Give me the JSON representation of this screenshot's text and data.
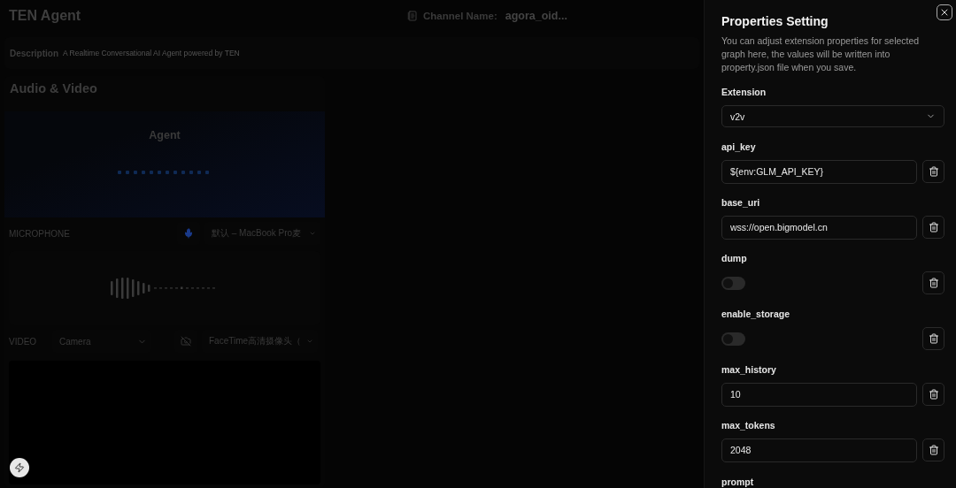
{
  "header": {
    "title": "TEN Agent",
    "channel_label": "Channel Name:",
    "channel_value": "agora_oid..."
  },
  "description": {
    "label": "Description",
    "text": "A Realtime Conversational AI Agent powered by TEN"
  },
  "audio_video": {
    "title": "Audio & Video",
    "agent_label": "Agent",
    "microphone": {
      "label": "MICROPHONE",
      "device": "默认 – MacBook Pro麦"
    },
    "video": {
      "label": "VIDEO",
      "source": "Camera",
      "device": "FaceTime高清摄像头（"
    }
  },
  "drawer": {
    "title": "Properties Setting",
    "intro": "You can adjust extension properties for selected graph here, the values will be written into property.json file when you save.",
    "extension": {
      "label": "Extension",
      "value": "v2v"
    },
    "properties": [
      {
        "kind": "text",
        "label": "api_key",
        "value": "${env:GLM_API_KEY}"
      },
      {
        "kind": "text",
        "label": "base_uri",
        "value": "wss://open.bigmodel.cn"
      },
      {
        "kind": "toggle",
        "label": "dump",
        "on": false
      },
      {
        "kind": "toggle",
        "label": "enable_storage",
        "on": false
      },
      {
        "kind": "text",
        "label": "max_history",
        "value": "10"
      },
      {
        "kind": "text",
        "label": "max_tokens",
        "value": "2048"
      },
      {
        "kind": "label",
        "label": "prompt"
      }
    ]
  }
}
